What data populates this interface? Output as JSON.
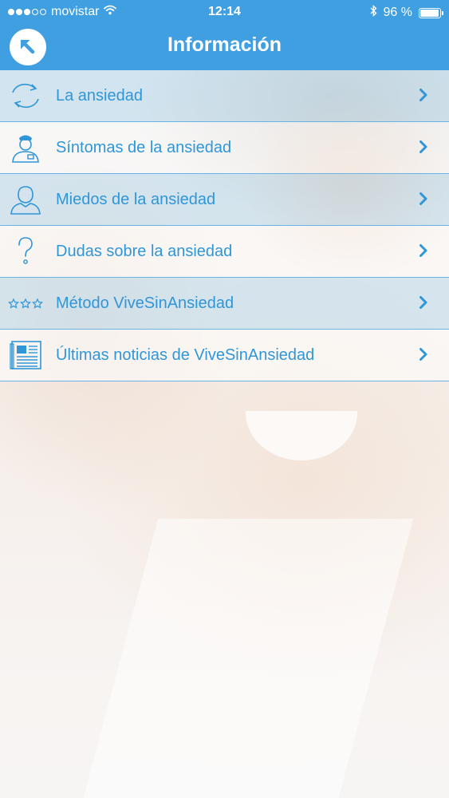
{
  "status_bar": {
    "carrier": "movistar",
    "time": "12:14",
    "battery_text": "96 %",
    "battery_level": 0.96,
    "signal_bars_filled": 3,
    "signal_bars_total": 5,
    "icons": [
      "wifi-icon",
      "bluetooth-icon",
      "battery-icon"
    ]
  },
  "nav": {
    "title": "Información",
    "back_icon": "arrow-up-left-icon"
  },
  "menu": {
    "items": [
      {
        "label": "La ansiedad",
        "icon": "cycle-arrows-icon"
      },
      {
        "label": "Síntomas de la ansiedad",
        "icon": "doctor-icon"
      },
      {
        "label": "Miedos de la ansiedad",
        "icon": "person-icon"
      },
      {
        "label": "Dudas sobre la ansiedad",
        "icon": "question-icon"
      },
      {
        "label": "Método ViveSinAnsiedad",
        "icon": "stars-icon"
      },
      {
        "label": "Últimas noticias de ViveSinAnsiedad",
        "icon": "newspaper-icon"
      }
    ]
  },
  "colors": {
    "accent": "#3f9fe0",
    "item_text": "#2f96d8",
    "separator": "#67b3e6"
  }
}
